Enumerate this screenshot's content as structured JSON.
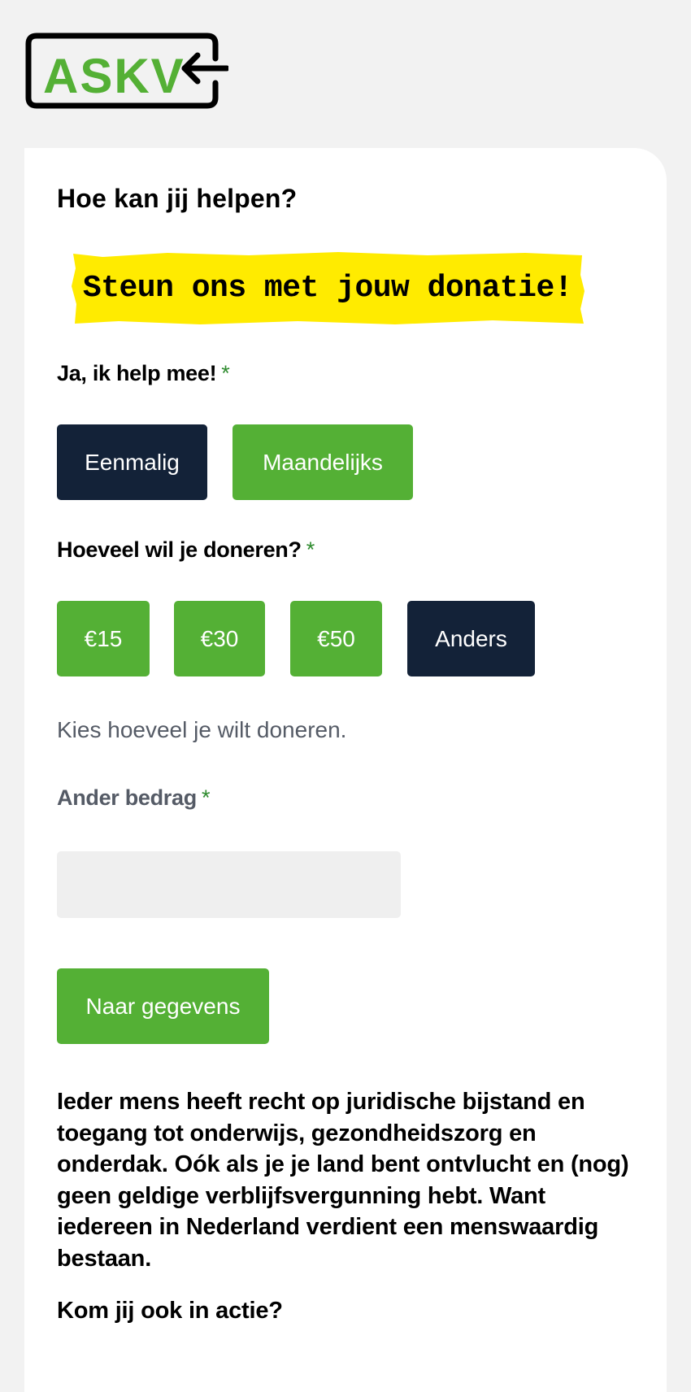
{
  "logo": {
    "text": "ASKV",
    "brand_color": "#54b035",
    "icon": "arrow-left-icon"
  },
  "form": {
    "title": "Hoe kan jij helpen?",
    "banner": "Steun ons met jouw donatie!",
    "banner_color": "#ffeb00",
    "frequency": {
      "label": "Ja, ik help mee!",
      "required_mark": "*",
      "options": [
        "Eenmalig",
        "Maandelijks"
      ],
      "selected": "Eenmalig"
    },
    "amount": {
      "label": "Hoeveel wil je doneren?",
      "required_mark": "*",
      "options": [
        "€15",
        "€30",
        "€50",
        "Anders"
      ],
      "selected": "Anders",
      "help": "Kies hoeveel je wilt doneren."
    },
    "other_amount": {
      "label": "Ander bedrag",
      "required_mark": "*",
      "value": "",
      "placeholder": ""
    },
    "submit_label": "Naar gegevens"
  },
  "content": {
    "body": "Ieder mens heeft recht op juridische bijstand en toegang tot onderwijs, gezondheidszorg en onderdak. Oók als je je land bent ontvlucht en (nog) geen geldige verblijfsvergunning hebt. Want iedereen in Nederland verdient een menswaardig bestaan.",
    "cta_heading": "Kom jij ook in actie?"
  },
  "colors": {
    "selected_button": "#132238",
    "unselected_button": "#54b035",
    "background": "#f2f2f2"
  }
}
